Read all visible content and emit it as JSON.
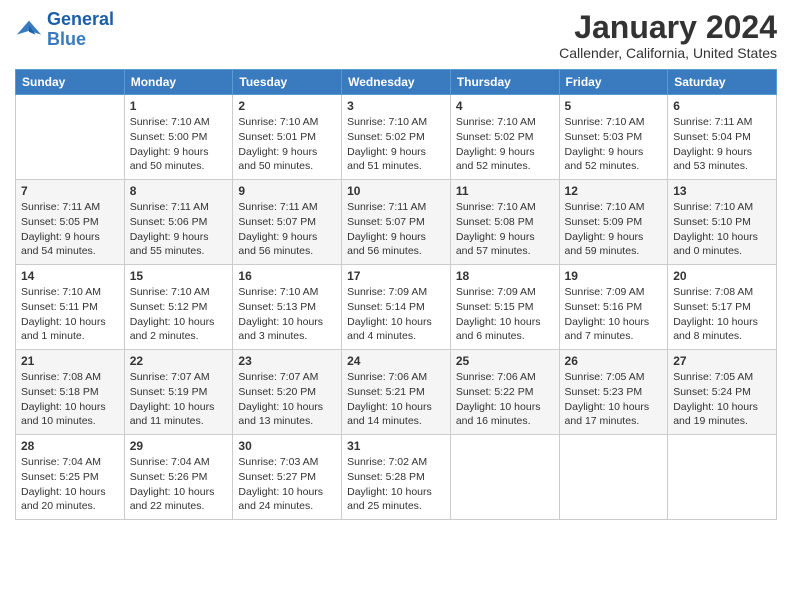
{
  "logo": {
    "line1": "General",
    "line2": "Blue"
  },
  "header": {
    "month_year": "January 2024",
    "location": "Callender, California, United States"
  },
  "days_of_week": [
    "Sunday",
    "Monday",
    "Tuesday",
    "Wednesday",
    "Thursday",
    "Friday",
    "Saturday"
  ],
  "weeks": [
    [
      {
        "day": "",
        "sunrise": "",
        "sunset": "",
        "daylight": ""
      },
      {
        "day": "1",
        "sunrise": "Sunrise: 7:10 AM",
        "sunset": "Sunset: 5:00 PM",
        "daylight": "Daylight: 9 hours and 50 minutes."
      },
      {
        "day": "2",
        "sunrise": "Sunrise: 7:10 AM",
        "sunset": "Sunset: 5:01 PM",
        "daylight": "Daylight: 9 hours and 50 minutes."
      },
      {
        "day": "3",
        "sunrise": "Sunrise: 7:10 AM",
        "sunset": "Sunset: 5:02 PM",
        "daylight": "Daylight: 9 hours and 51 minutes."
      },
      {
        "day": "4",
        "sunrise": "Sunrise: 7:10 AM",
        "sunset": "Sunset: 5:02 PM",
        "daylight": "Daylight: 9 hours and 52 minutes."
      },
      {
        "day": "5",
        "sunrise": "Sunrise: 7:10 AM",
        "sunset": "Sunset: 5:03 PM",
        "daylight": "Daylight: 9 hours and 52 minutes."
      },
      {
        "day": "6",
        "sunrise": "Sunrise: 7:11 AM",
        "sunset": "Sunset: 5:04 PM",
        "daylight": "Daylight: 9 hours and 53 minutes."
      }
    ],
    [
      {
        "day": "7",
        "sunrise": "Sunrise: 7:11 AM",
        "sunset": "Sunset: 5:05 PM",
        "daylight": "Daylight: 9 hours and 54 minutes."
      },
      {
        "day": "8",
        "sunrise": "Sunrise: 7:11 AM",
        "sunset": "Sunset: 5:06 PM",
        "daylight": "Daylight: 9 hours and 55 minutes."
      },
      {
        "day": "9",
        "sunrise": "Sunrise: 7:11 AM",
        "sunset": "Sunset: 5:07 PM",
        "daylight": "Daylight: 9 hours and 56 minutes."
      },
      {
        "day": "10",
        "sunrise": "Sunrise: 7:11 AM",
        "sunset": "Sunset: 5:07 PM",
        "daylight": "Daylight: 9 hours and 56 minutes."
      },
      {
        "day": "11",
        "sunrise": "Sunrise: 7:10 AM",
        "sunset": "Sunset: 5:08 PM",
        "daylight": "Daylight: 9 hours and 57 minutes."
      },
      {
        "day": "12",
        "sunrise": "Sunrise: 7:10 AM",
        "sunset": "Sunset: 5:09 PM",
        "daylight": "Daylight: 9 hours and 59 minutes."
      },
      {
        "day": "13",
        "sunrise": "Sunrise: 7:10 AM",
        "sunset": "Sunset: 5:10 PM",
        "daylight": "Daylight: 10 hours and 0 minutes."
      }
    ],
    [
      {
        "day": "14",
        "sunrise": "Sunrise: 7:10 AM",
        "sunset": "Sunset: 5:11 PM",
        "daylight": "Daylight: 10 hours and 1 minute."
      },
      {
        "day": "15",
        "sunrise": "Sunrise: 7:10 AM",
        "sunset": "Sunset: 5:12 PM",
        "daylight": "Daylight: 10 hours and 2 minutes."
      },
      {
        "day": "16",
        "sunrise": "Sunrise: 7:10 AM",
        "sunset": "Sunset: 5:13 PM",
        "daylight": "Daylight: 10 hours and 3 minutes."
      },
      {
        "day": "17",
        "sunrise": "Sunrise: 7:09 AM",
        "sunset": "Sunset: 5:14 PM",
        "daylight": "Daylight: 10 hours and 4 minutes."
      },
      {
        "day": "18",
        "sunrise": "Sunrise: 7:09 AM",
        "sunset": "Sunset: 5:15 PM",
        "daylight": "Daylight: 10 hours and 6 minutes."
      },
      {
        "day": "19",
        "sunrise": "Sunrise: 7:09 AM",
        "sunset": "Sunset: 5:16 PM",
        "daylight": "Daylight: 10 hours and 7 minutes."
      },
      {
        "day": "20",
        "sunrise": "Sunrise: 7:08 AM",
        "sunset": "Sunset: 5:17 PM",
        "daylight": "Daylight: 10 hours and 8 minutes."
      }
    ],
    [
      {
        "day": "21",
        "sunrise": "Sunrise: 7:08 AM",
        "sunset": "Sunset: 5:18 PM",
        "daylight": "Daylight: 10 hours and 10 minutes."
      },
      {
        "day": "22",
        "sunrise": "Sunrise: 7:07 AM",
        "sunset": "Sunset: 5:19 PM",
        "daylight": "Daylight: 10 hours and 11 minutes."
      },
      {
        "day": "23",
        "sunrise": "Sunrise: 7:07 AM",
        "sunset": "Sunset: 5:20 PM",
        "daylight": "Daylight: 10 hours and 13 minutes."
      },
      {
        "day": "24",
        "sunrise": "Sunrise: 7:06 AM",
        "sunset": "Sunset: 5:21 PM",
        "daylight": "Daylight: 10 hours and 14 minutes."
      },
      {
        "day": "25",
        "sunrise": "Sunrise: 7:06 AM",
        "sunset": "Sunset: 5:22 PM",
        "daylight": "Daylight: 10 hours and 16 minutes."
      },
      {
        "day": "26",
        "sunrise": "Sunrise: 7:05 AM",
        "sunset": "Sunset: 5:23 PM",
        "daylight": "Daylight: 10 hours and 17 minutes."
      },
      {
        "day": "27",
        "sunrise": "Sunrise: 7:05 AM",
        "sunset": "Sunset: 5:24 PM",
        "daylight": "Daylight: 10 hours and 19 minutes."
      }
    ],
    [
      {
        "day": "28",
        "sunrise": "Sunrise: 7:04 AM",
        "sunset": "Sunset: 5:25 PM",
        "daylight": "Daylight: 10 hours and 20 minutes."
      },
      {
        "day": "29",
        "sunrise": "Sunrise: 7:04 AM",
        "sunset": "Sunset: 5:26 PM",
        "daylight": "Daylight: 10 hours and 22 minutes."
      },
      {
        "day": "30",
        "sunrise": "Sunrise: 7:03 AM",
        "sunset": "Sunset: 5:27 PM",
        "daylight": "Daylight: 10 hours and 24 minutes."
      },
      {
        "day": "31",
        "sunrise": "Sunrise: 7:02 AM",
        "sunset": "Sunset: 5:28 PM",
        "daylight": "Daylight: 10 hours and 25 minutes."
      },
      {
        "day": "",
        "sunrise": "",
        "sunset": "",
        "daylight": ""
      },
      {
        "day": "",
        "sunrise": "",
        "sunset": "",
        "daylight": ""
      },
      {
        "day": "",
        "sunrise": "",
        "sunset": "",
        "daylight": ""
      }
    ]
  ]
}
